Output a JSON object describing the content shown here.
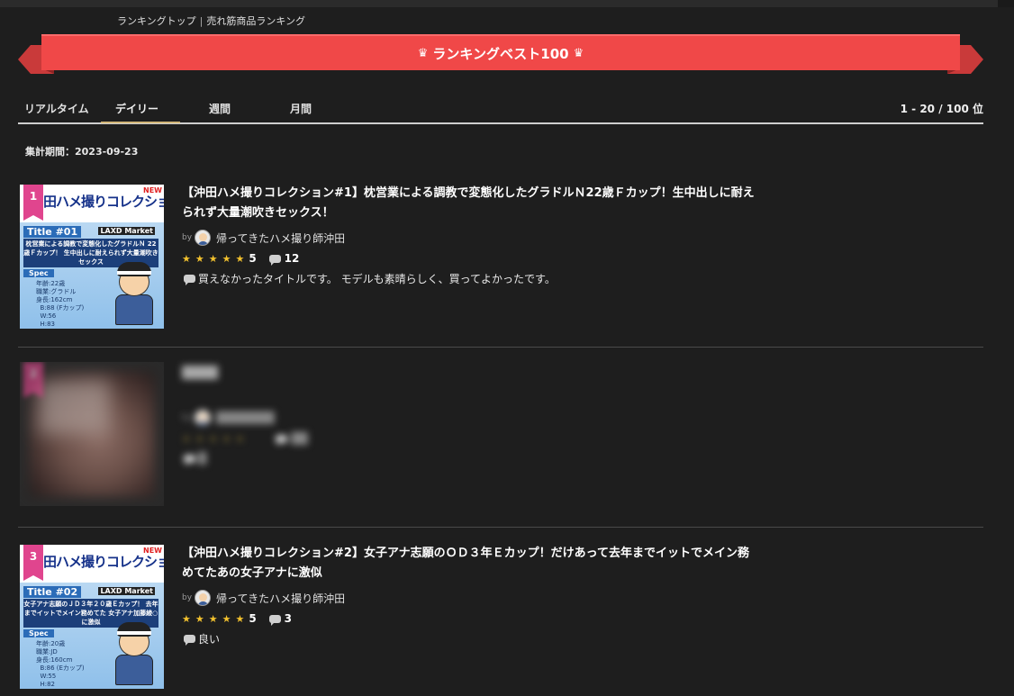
{
  "breadcrumb": {
    "top": "ランキングトップ",
    "separator": "|",
    "current": "売れ筋商品ランキング"
  },
  "banner": {
    "title": "ランキングベスト100",
    "icon": "crown-icon"
  },
  "tabs": [
    {
      "label": "リアルタイム",
      "active": false
    },
    {
      "label": "デイリー",
      "active": true
    },
    {
      "label": "週間",
      "active": false
    },
    {
      "label": "月間",
      "active": false
    }
  ],
  "range": "1 - 20 / 100 位",
  "period": "集計期間：2023-09-23",
  "items": [
    {
      "rank": "1",
      "title": "【沖田ハメ撮りコレクション#1】枕営業による調教で変態化したグラドルＮ22歳Ｆカップ！生中出しに耐えられず大量潮吹きセックス！",
      "by": "by",
      "author": "帰ってきたハメ撮り師沖田",
      "stars": "★★★★★",
      "rating": "5",
      "comments": "12",
      "review": "買えなかったタイトルです。 モデルも素晴らしく、買ってよかったです。",
      "thumb": {
        "head": "田ハメ撮りコレクショ",
        "new": "NEW",
        "title": "Title  #01",
        "brand": "LAXD Market",
        "sub": "枕営業による調教で変態化したグラドルＮ 22歳Ｆカップ！ 生中出しに耐えられず大量潮吹きセックス",
        "spec": "Spec",
        "lines": "年齢:22歳\n職業:グラドル\n身長:162cm\n  B:88 (Fカップ)\n  W:56\n  H:83"
      }
    },
    {
      "rank": "2",
      "title": "",
      "by": "by",
      "author": "",
      "stars": "★★★★★",
      "rating": "",
      "comments": "",
      "review": ""
    },
    {
      "rank": "3",
      "title": "【沖田ハメ撮りコレクション#2】女子アナ志願のＯＤ３年Ｅカップ！だけあって去年までイットでメイン務めてたあの女子アナに激似",
      "by": "by",
      "author": "帰ってきたハメ撮り師沖田",
      "stars": "★★★★★",
      "rating": "5",
      "comments": "3",
      "review": "良い",
      "thumb": {
        "head": "田ハメ撮りコレクショ",
        "new": "NEW",
        "title": "Title  #02",
        "brand": "LAXD Market",
        "sub": "女子アナ志願のＪＤ３年２０歳Ｅカップ！ 去年までイットでメイン務めてた 女子アナ加藤綾○に激似",
        "spec": "Spec",
        "lines": "年齢:20歳\n職業:JD\n身長:160cm\n  B:86 (Eカップ)\n  W:55\n  H:82"
      }
    }
  ],
  "colors": {
    "background": "#1e1e1e",
    "ribbon": "#f04848",
    "star": "#f2c12e",
    "rank_badge": "#e0458e",
    "tab_underline": "#d4b87a"
  }
}
